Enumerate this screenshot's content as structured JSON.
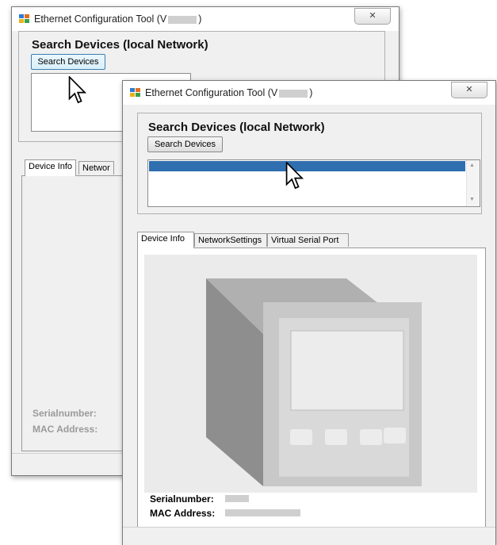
{
  "back_window": {
    "title": "Ethernet Configuration Tool (V",
    "title_suffix": ")",
    "close_glyph": "✕",
    "group_title": "Search Devices (local Network)",
    "search_button": "Search Devices",
    "tabs": [
      "Device Info",
      "Networ"
    ],
    "serial_label": "Serialnumber:",
    "mac_label": "MAC Address:"
  },
  "front_window": {
    "title": "Ethernet Configuration Tool (V",
    "title_suffix": ")",
    "close_glyph": "✕",
    "group_title": "Search Devices (local Network)",
    "search_button": "Search Devices",
    "tabs": [
      "Device Info",
      "NetworkSettings",
      "Virtual Serial Port"
    ],
    "active_tab": "Device Info",
    "serial_label": "Serialnumber:",
    "mac_label": "MAC Address:",
    "scroll_up_glyph": "▲",
    "scroll_down_glyph": "▼"
  },
  "colors": {
    "selection": "#2f6fb0",
    "window_bg": "#f0f0f0",
    "device_dark": "#9b9b9b",
    "device_front": "#cdcdcd"
  },
  "icons": [
    "app-icon",
    "close-icon",
    "mouse-cursor-icon",
    "scroll-up-icon",
    "scroll-down-icon",
    "device-image"
  ]
}
